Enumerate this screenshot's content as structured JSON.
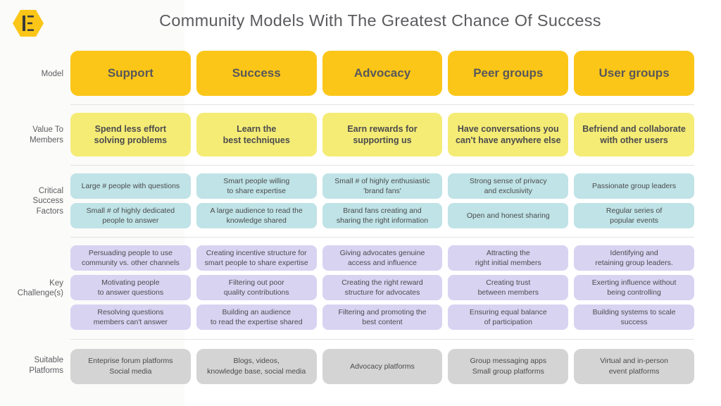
{
  "header": {
    "logo_icon": "hexagon-e-logo",
    "title": "Community Models With The Greatest Chance Of Success",
    "brand_color": "#fbc618"
  },
  "colors": {
    "model": "#fbc618",
    "value": "#f5ec76",
    "critical": "#bfe3e6",
    "key": "#d9d3f2",
    "platforms": "#d4d4d4",
    "divider": "#e3e3e3",
    "text": "#58585b"
  },
  "columns": [
    "Support",
    "Success",
    "Advocacy",
    "Peer groups",
    "User groups"
  ],
  "rows": [
    {
      "label": "Model",
      "key": "model",
      "cellrows": [
        [
          "Support",
          "Success",
          "Advocacy",
          "Peer groups",
          "User groups"
        ]
      ]
    },
    {
      "label": "Value To\nMembers",
      "key": "value",
      "cellrows": [
        [
          "Spend less effort\nsolving problems",
          "Learn the\nbest techniques",
          "Earn rewards for\nsupporting us",
          "Have conversations you\ncan't have anywhere else",
          "Befriend and collaborate\nwith other users"
        ]
      ]
    },
    {
      "label": "Critical\nSuccess\nFactors",
      "key": "critical",
      "cellrows": [
        [
          "Large # people with questions",
          "Smart people willing\nto share expertise",
          "Small # of highly enthusiastic\n'brand fans'",
          "Strong sense of privacy\nand exclusivity",
          "Passionate group leaders"
        ],
        [
          "Small # of highly dedicated\npeople to answer",
          "A large audience to read the\nknowledge shared",
          "Brand fans creating and\nsharing the right information",
          "Open and honest sharing",
          "Regular series of\npopular events"
        ]
      ]
    },
    {
      "label": "Key\nChallenge(s)",
      "key": "key",
      "cellrows": [
        [
          "Persuading people to use\ncommunity vs. other channels",
          "Creating incentive structure for\nsmart people to share expertise",
          "Giving advocates genuine\naccess and influence",
          "Attracting the\nright initial members",
          "Identifying and\nretaining group leaders."
        ],
        [
          "Motivating people\nto answer questions",
          "Filtering out poor\nquality contributions",
          "Creating the right reward\nstructure for advocates",
          "Creating trust\nbetween members",
          "Exerting influence without\nbeing controlling"
        ],
        [
          "Resolving questions\nmembers can't answer",
          "Building an audience\nto read the expertise shared",
          "Filtering and promoting the\nbest content",
          "Ensuring equal balance\nof participation",
          "Building systems to scale\nsuccess"
        ]
      ]
    },
    {
      "label": "Suitable\nPlatforms",
      "key": "platforms",
      "cellrows": [
        [
          "Enteprise forum platforms\nSocial media",
          "Blogs, videos,\nknowledge base, social media",
          "Advocacy platforms",
          "Group messaging apps\nSmall group platforms",
          "Virtual and in-person\nevent platforms"
        ]
      ]
    }
  ]
}
